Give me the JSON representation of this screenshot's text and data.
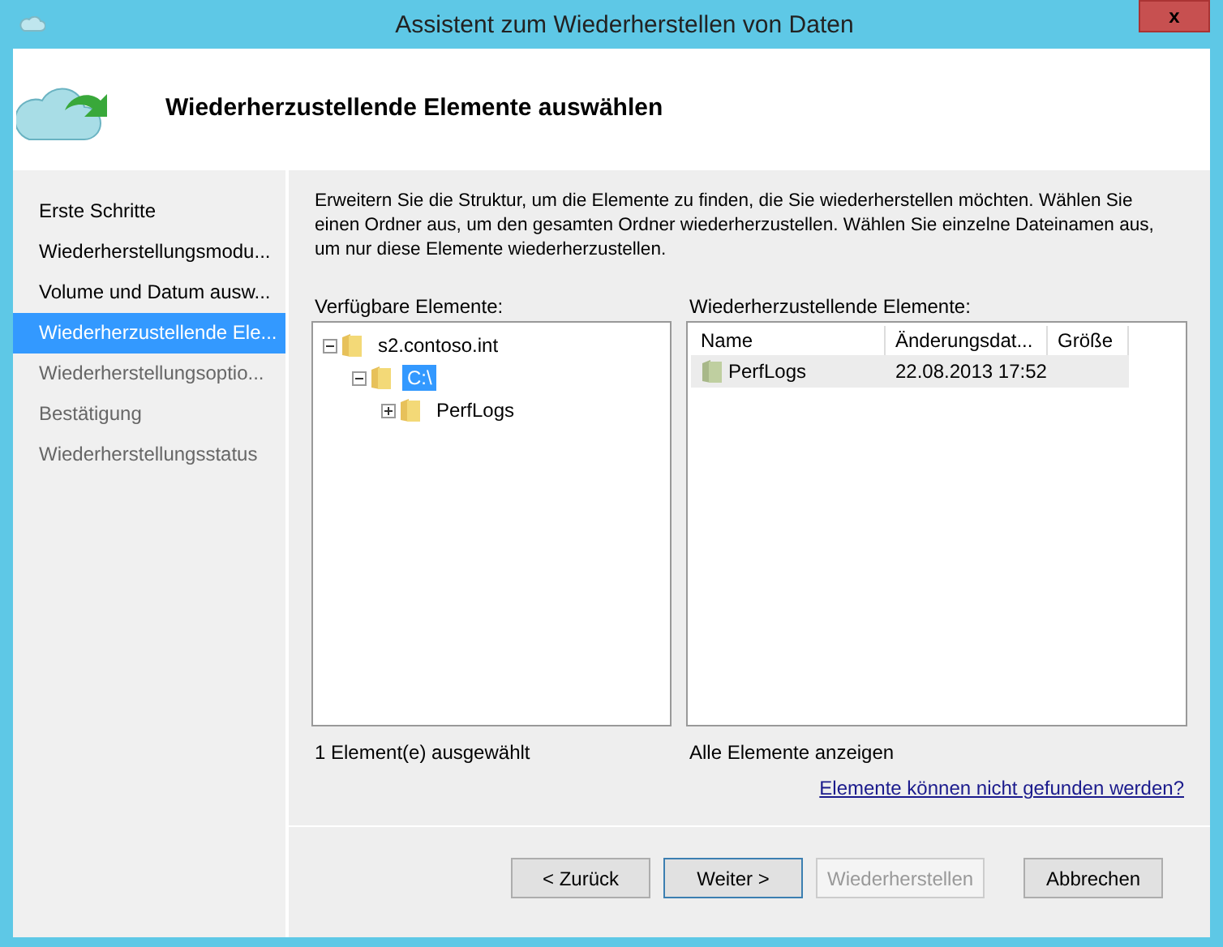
{
  "window": {
    "title": "Assistent zum Wiederherstellen von Daten",
    "close": "x"
  },
  "header": {
    "title": "Wiederherzustellende Elemente auswählen"
  },
  "steps": [
    {
      "label": "Erste Schritte",
      "selected": false,
      "disabled": false
    },
    {
      "label": "Wiederherstellungsmodu...",
      "selected": false,
      "disabled": false
    },
    {
      "label": "Volume und Datum ausw...",
      "selected": false,
      "disabled": false
    },
    {
      "label": "Wiederherzustellende Ele...",
      "selected": true,
      "disabled": false
    },
    {
      "label": "Wiederherstellungsoptio...",
      "selected": false,
      "disabled": true
    },
    {
      "label": "Bestätigung",
      "selected": false,
      "disabled": true
    },
    {
      "label": "Wiederherstellungsstatus",
      "selected": false,
      "disabled": true
    }
  ],
  "instructions": "Erweitern Sie die Struktur, um die Elemente zu finden, die Sie wiederherstellen möchten. Wählen Sie einen Ordner aus, um den gesamten Ordner wiederherzustellen. Wählen Sie einzelne Dateinamen aus, um nur diese Elemente wiederherzustellen.",
  "available": {
    "label": "Verfügbare Elemente:",
    "tree": [
      {
        "label": "s2.contoso.int",
        "expanded": true,
        "selected": false,
        "children": [
          {
            "label": "C:\\",
            "expanded": true,
            "selected": true,
            "children": [
              {
                "label": "PerfLogs",
                "expanded": false,
                "selected": false
              }
            ]
          }
        ]
      }
    ],
    "status": "1 Element(e) ausgewählt"
  },
  "to_restore": {
    "label": "Wiederherzustellende Elemente:",
    "columns": [
      "Name",
      "Änderungsdat...",
      "Größe"
    ],
    "rows": [
      {
        "name": "PerfLogs",
        "modified": "22.08.2013 17:52",
        "size": ""
      }
    ],
    "show_all": "Alle Elemente anzeigen"
  },
  "help_link": "Elemente können nicht gefunden werden?",
  "buttons": [
    {
      "label": "< Zurück",
      "disabled": false,
      "default": false
    },
    {
      "label": "Weiter >",
      "disabled": false,
      "default": true
    },
    {
      "label": "Wiederherstellen",
      "disabled": true,
      "default": false
    },
    {
      "label": "Abbrechen",
      "disabled": false,
      "default": false
    }
  ]
}
